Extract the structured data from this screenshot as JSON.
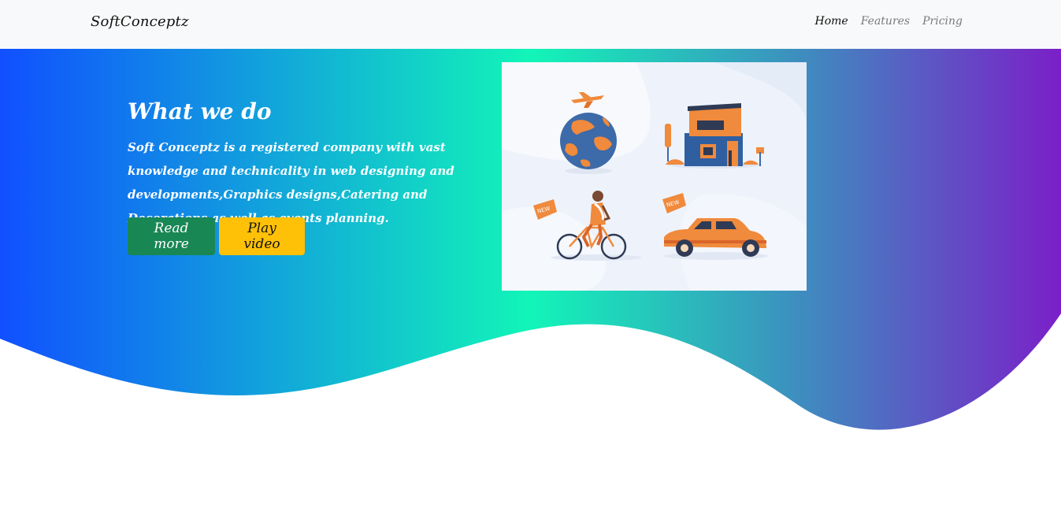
{
  "navbar": {
    "brand": "SoftConceptz",
    "links": [
      {
        "label": "Home",
        "active": true
      },
      {
        "label": "Features",
        "active": false
      },
      {
        "label": "Pricing",
        "active": false
      }
    ]
  },
  "hero": {
    "title": "What we do",
    "description": "Soft Conceptz is a registered company with vast knowledge and technicality in web designing and developments,Graphics designs,Catering and Decorations as well as events planning.",
    "buttons": {
      "read_more": "Read more",
      "play_video": "Play video"
    },
    "illustration": {
      "badge_1": "NEW",
      "badge_2": "NEW"
    }
  },
  "colors": {
    "gradient_left": "#1150ff",
    "gradient_mid": "#12f5b8",
    "gradient_right": "#7b1fc8",
    "read_more_bg": "#198754",
    "play_video_bg": "#ffc107"
  }
}
